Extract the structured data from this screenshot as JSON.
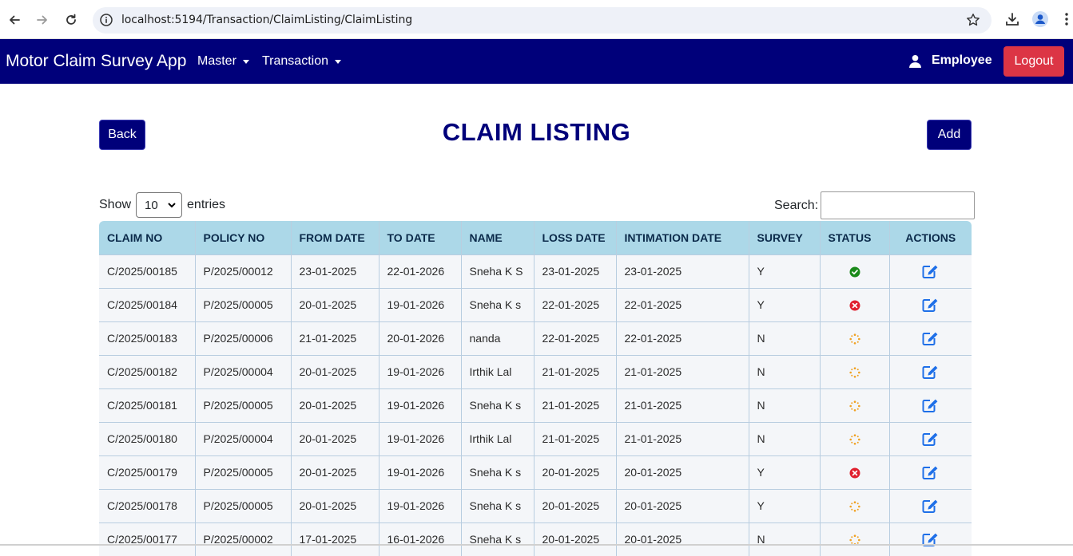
{
  "browser": {
    "url": "localhost:5194/Transaction/ClaimListing/ClaimListing"
  },
  "navbar": {
    "brand": "Motor Claim Survey App",
    "menus": [
      "Master",
      "Transaction"
    ],
    "user": "Employee",
    "logout": "Logout"
  },
  "page": {
    "back": "Back",
    "title": "CLAIM LISTING",
    "add": "Add",
    "show_label": "Show",
    "entries_value": "10",
    "entries_label": "entries",
    "search_label": "Search:"
  },
  "table": {
    "headers": [
      "CLAIM NO",
      "POLICY NO",
      "FROM DATE",
      "TO DATE",
      "NAME",
      "LOSS DATE",
      "INTIMATION DATE",
      "SURVEY",
      "STATUS",
      "ACTIONS"
    ],
    "rows": [
      {
        "claim_no": "C/2025/00185",
        "policy_no": "P/2025/00012",
        "from": "23-01-2025",
        "to": "22-01-2026",
        "name": "Sneha K S",
        "loss": "23-01-2025",
        "intimation": "23-01-2025",
        "survey": "Y",
        "status": "approved"
      },
      {
        "claim_no": "C/2025/00184",
        "policy_no": "P/2025/00005",
        "from": "20-01-2025",
        "to": "19-01-2026",
        "name": "Sneha K s",
        "loss": "22-01-2025",
        "intimation": "22-01-2025",
        "survey": "Y",
        "status": "rejected"
      },
      {
        "claim_no": "C/2025/00183",
        "policy_no": "P/2025/00006",
        "from": "21-01-2025",
        "to": "20-01-2026",
        "name": "nanda",
        "loss": "22-01-2025",
        "intimation": "22-01-2025",
        "survey": "N",
        "status": "pending"
      },
      {
        "claim_no": "C/2025/00182",
        "policy_no": "P/2025/00004",
        "from": "20-01-2025",
        "to": "19-01-2026",
        "name": "Irthik Lal",
        "loss": "21-01-2025",
        "intimation": "21-01-2025",
        "survey": "N",
        "status": "pending"
      },
      {
        "claim_no": "C/2025/00181",
        "policy_no": "P/2025/00005",
        "from": "20-01-2025",
        "to": "19-01-2026",
        "name": "Sneha K s",
        "loss": "21-01-2025",
        "intimation": "21-01-2025",
        "survey": "N",
        "status": "pending"
      },
      {
        "claim_no": "C/2025/00180",
        "policy_no": "P/2025/00004",
        "from": "20-01-2025",
        "to": "19-01-2026",
        "name": "Irthik Lal",
        "loss": "21-01-2025",
        "intimation": "21-01-2025",
        "survey": "N",
        "status": "pending"
      },
      {
        "claim_no": "C/2025/00179",
        "policy_no": "P/2025/00005",
        "from": "20-01-2025",
        "to": "19-01-2026",
        "name": "Sneha K s",
        "loss": "20-01-2025",
        "intimation": "20-01-2025",
        "survey": "Y",
        "status": "rejected"
      },
      {
        "claim_no": "C/2025/00178",
        "policy_no": "P/2025/00005",
        "from": "20-01-2025",
        "to": "19-01-2026",
        "name": "Sneha K s",
        "loss": "20-01-2025",
        "intimation": "20-01-2025",
        "survey": "Y",
        "status": "pending"
      },
      {
        "claim_no": "C/2025/00177",
        "policy_no": "P/2025/00002",
        "from": "17-01-2025",
        "to": "16-01-2026",
        "name": "Sneha K s",
        "loss": "20-01-2025",
        "intimation": "20-01-2025",
        "survey": "N",
        "status": "pending"
      }
    ]
  },
  "icons": {
    "approved": "check-circle-icon",
    "rejected": "x-circle-icon",
    "pending": "spinner-icon",
    "edit": "edit-icon"
  },
  "colors": {
    "navy": "#00007a",
    "logout": "#dc3545",
    "approved": "#1a8a1a",
    "rejected": "#e0202e",
    "pending": "#f0a020",
    "edit": "#1e6fe8",
    "header_bg": "#acd8e8"
  }
}
